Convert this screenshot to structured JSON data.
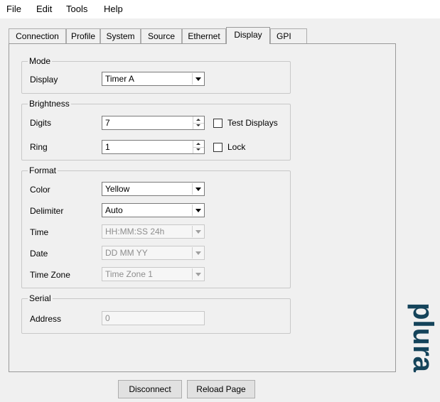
{
  "menu": [
    "File",
    "Edit",
    "Tools",
    "Help"
  ],
  "tabs": [
    "Connection",
    "Profile",
    "System",
    "Source",
    "Ethernet",
    "Display",
    "GPI"
  ],
  "active_tab": "Display",
  "mode": {
    "title": "Mode",
    "display_label": "Display",
    "display_value": "Timer A"
  },
  "brightness": {
    "title": "Brightness",
    "digits_label": "Digits",
    "digits_value": "7",
    "ring_label": "Ring",
    "ring_value": "1",
    "test_displays_label": "Test Displays",
    "lock_label": "Lock"
  },
  "format": {
    "title": "Format",
    "color_label": "Color",
    "color_value": "Yellow",
    "delimiter_label": "Delimiter",
    "delimiter_value": "Auto",
    "time_label": "Time",
    "time_value": "HH:MM:SS 24h",
    "date_label": "Date",
    "date_value": "DD MM YY",
    "timezone_label": "Time Zone",
    "timezone_value": "Time Zone 1"
  },
  "serial": {
    "title": "Serial",
    "address_label": "Address",
    "address_value": "0"
  },
  "buttons": {
    "disconnect": "Disconnect",
    "reload": "Reload Page"
  },
  "logo_text": "plura",
  "colors": {
    "logo": "#14435a"
  }
}
